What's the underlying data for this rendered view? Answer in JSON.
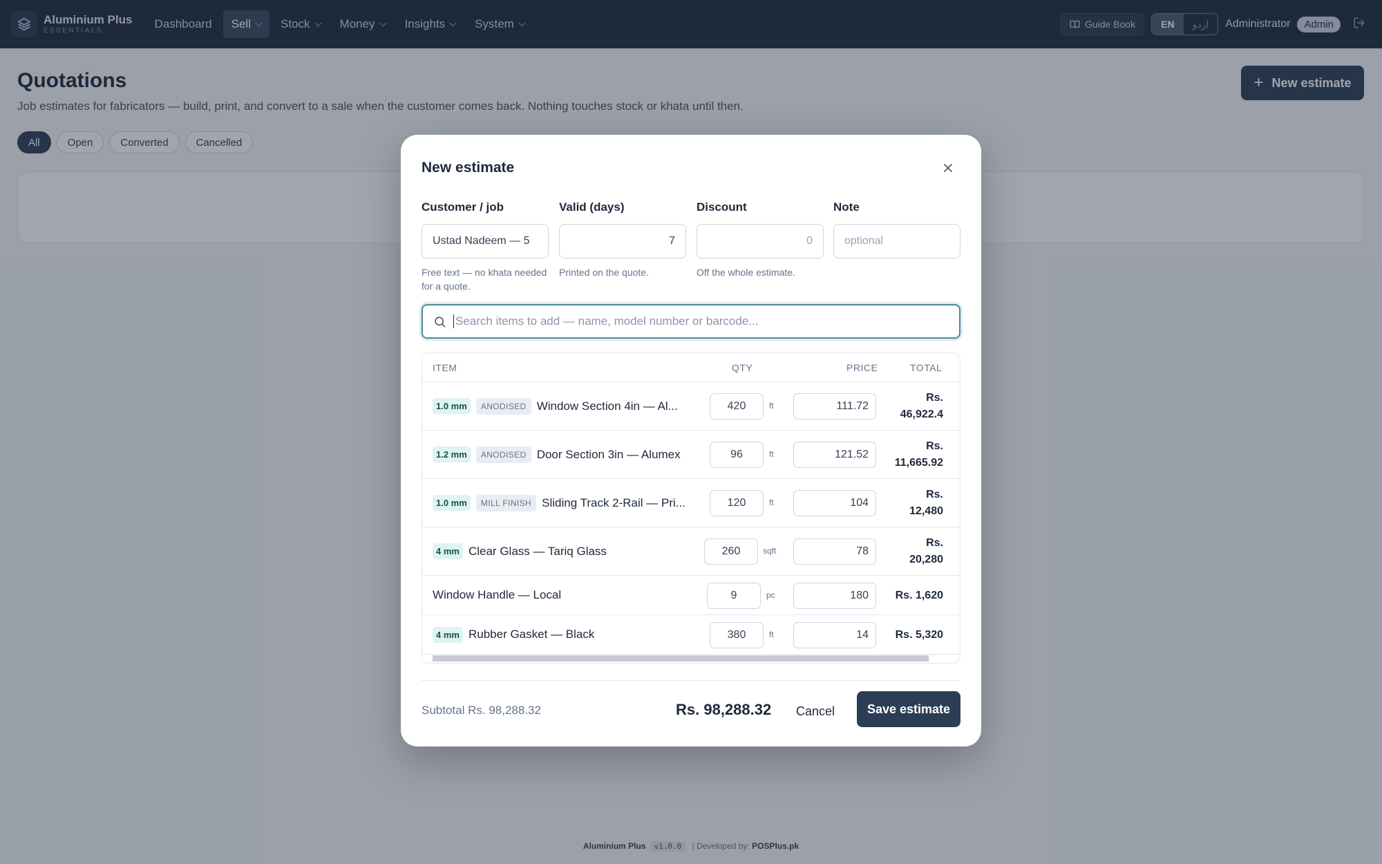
{
  "app": {
    "name": "Aluminium Plus",
    "sub": "ESSENTIALS"
  },
  "nav": [
    {
      "label": "Dashboard",
      "dropdown": false,
      "active": false
    },
    {
      "label": "Sell",
      "dropdown": true,
      "active": true
    },
    {
      "label": "Stock",
      "dropdown": true,
      "active": false
    },
    {
      "label": "Money",
      "dropdown": true,
      "active": false
    },
    {
      "label": "Insights",
      "dropdown": true,
      "active": false
    },
    {
      "label": "System",
      "dropdown": true,
      "active": false
    }
  ],
  "header": {
    "guide": "Guide Book",
    "lang": {
      "en": "EN",
      "ur": "اردو",
      "selected": "EN"
    },
    "user": "Administrator",
    "role": "Admin"
  },
  "page": {
    "title": "Quotations",
    "subtitle": "Job estimates for fabricators — build, print, and convert to a sale when the customer comes back. Nothing touches stock or khata until then.",
    "new_button": "New estimate",
    "filters": [
      "All",
      "Open",
      "Converted",
      "Cancelled"
    ],
    "active_filter": "All"
  },
  "modal": {
    "title": "New estimate",
    "fields": {
      "customer": {
        "label": "Customer / job",
        "value": "Ustad Nadeem — 5",
        "help": "Free text — no khata needed for a quote."
      },
      "valid": {
        "label": "Valid (days)",
        "value": "7",
        "help": "Printed on the quote."
      },
      "discount": {
        "label": "Discount",
        "value": "0",
        "help": "Off the whole estimate."
      },
      "note": {
        "label": "Note",
        "placeholder": "optional"
      }
    },
    "search_placeholder": "Search items to add — name, model number or barcode...",
    "columns": {
      "item": "ITEM",
      "qty": "QTY",
      "price": "PRICE",
      "total": "TOTAL"
    },
    "items": [
      {
        "mm": "1.0 mm",
        "finish": "ANODISED",
        "name": "Window Section 4in — Al...",
        "qty": "420",
        "unit": "ft",
        "price": "111.72",
        "total_line1": "Rs.",
        "total_line2": "46,922.4"
      },
      {
        "mm": "1.2 mm",
        "finish": "ANODISED",
        "name": "Door Section 3in — Alumex",
        "qty": "96",
        "unit": "ft",
        "price": "121.52",
        "total_line1": "Rs.",
        "total_line2": "11,665.92"
      },
      {
        "mm": "1.0 mm",
        "finish": "MILL FINISH",
        "name": "Sliding Track 2-Rail — Pri...",
        "qty": "120",
        "unit": "ft",
        "price": "104",
        "total_line1": "Rs.",
        "total_line2": "12,480"
      },
      {
        "mm": "4 mm",
        "finish": "",
        "name": "Clear Glass — Tariq Glass",
        "qty": "260",
        "unit": "sqft",
        "price": "78",
        "total_line1": "Rs.",
        "total_line2": "20,280"
      },
      {
        "mm": "",
        "finish": "",
        "name": "Window Handle — Local",
        "qty": "9",
        "unit": "pc",
        "price": "180",
        "total_line1": "Rs. 1,620",
        "total_line2": ""
      },
      {
        "mm": "4 mm",
        "finish": "",
        "name": "Rubber Gasket — Black",
        "qty": "380",
        "unit": "ft",
        "price": "14",
        "total_line1": "Rs. 5,320",
        "total_line2": ""
      }
    ],
    "subtotal": "Subtotal Rs. 98,288.32",
    "grand_total": "Rs. 98,288.32",
    "cancel": "Cancel",
    "save": "Save estimate"
  },
  "footer": {
    "brand": "Aluminium Plus",
    "version": "v1.0.0",
    "dev_label": "Developed by:",
    "dev": "POSPlus.pk"
  },
  "colors": {
    "nav_bg": "#1e2a3d",
    "primary": "#2c3e55",
    "search_focus": "#4a8a98",
    "tag_mm_bg": "#dff3f0"
  }
}
